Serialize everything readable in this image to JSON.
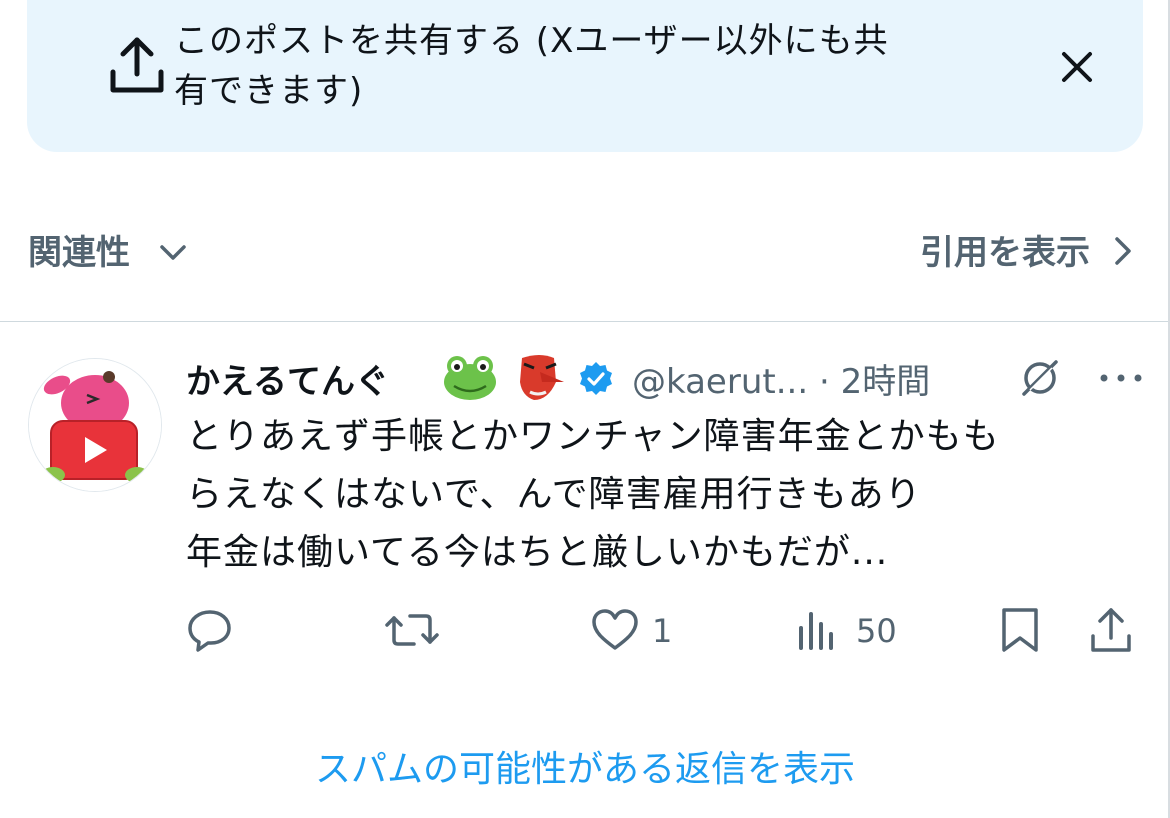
{
  "share_banner": {
    "text_line1": "このポストを共有する (Xユーザー以外にも共",
    "text_line2": "有できます)"
  },
  "sort": {
    "label": "関連性"
  },
  "quotes": {
    "label": "引用を表示"
  },
  "post": {
    "display_name": "かえるてんぐ",
    "emojis": [
      "frog-face",
      "tengu-mask"
    ],
    "verified": true,
    "handle": "@kaerut...",
    "separator": "·",
    "timestamp": "2時間",
    "text_lines": [
      "とりあえず手帳とかワンチャン障害年金とかもも",
      "らえなくはないで、んで障害雇用行きもあり",
      "年金は働いてる今はちと厳しいかもだが..."
    ],
    "actions": {
      "reply_count": "",
      "repost_count": "",
      "like_count": "1",
      "views_count": "50"
    }
  },
  "spam_link": {
    "label": "スパムの可能性がある返信を表示"
  },
  "colors": {
    "accent": "#1d9bf0",
    "banner_bg": "#e8f5fd",
    "secondary_text": "#536471",
    "primary_text": "#0f1419"
  }
}
